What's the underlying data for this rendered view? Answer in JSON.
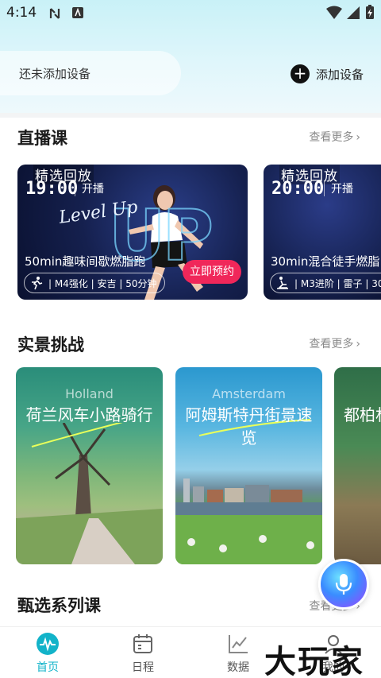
{
  "status_bar": {
    "time": "4:14"
  },
  "device": {
    "empty_text": "还未添加设备",
    "add_label": "添加设备",
    "add_symbol": "+"
  },
  "sections": {
    "live": {
      "title": "直播课",
      "more": "查看更多"
    },
    "scenic": {
      "title": "实景挑战",
      "more": "查看更多"
    },
    "series": {
      "title": "甄选系列课",
      "more": "查看更多"
    }
  },
  "live_cards": [
    {
      "badge": "精选回放",
      "time": "19:00",
      "start": "开播",
      "name": "50min趣味间歇燃脂跑",
      "meta": "| M4强化 | 安吉 | 50分钟",
      "button": "立即预约",
      "art_text": "Level Up",
      "art_letters": "UP"
    },
    {
      "badge": "精选回放",
      "time": "20:00",
      "start": "开播",
      "name": "30min混合徒手燃脂",
      "meta": "| M3进阶 | 雷子 | 30"
    }
  ],
  "scenic_cards": [
    {
      "en": "Holland",
      "cn": "荷兰风车小路骑行"
    },
    {
      "en": "Amsterdam",
      "cn": "阿姆斯特丹街景速览"
    },
    {
      "en": "",
      "cn": "都柏林"
    }
  ],
  "nav": [
    {
      "label": "首页",
      "icon": "home-pulse-icon",
      "active": true
    },
    {
      "label": "日程",
      "icon": "calendar-icon",
      "active": false
    },
    {
      "label": "数据",
      "icon": "chart-icon",
      "active": false
    },
    {
      "label": "我的",
      "icon": "profile-icon",
      "active": false
    }
  ],
  "watermark": "大玩家",
  "colors": {
    "accent": "#12b3c9",
    "book_button": "#f0275a"
  }
}
